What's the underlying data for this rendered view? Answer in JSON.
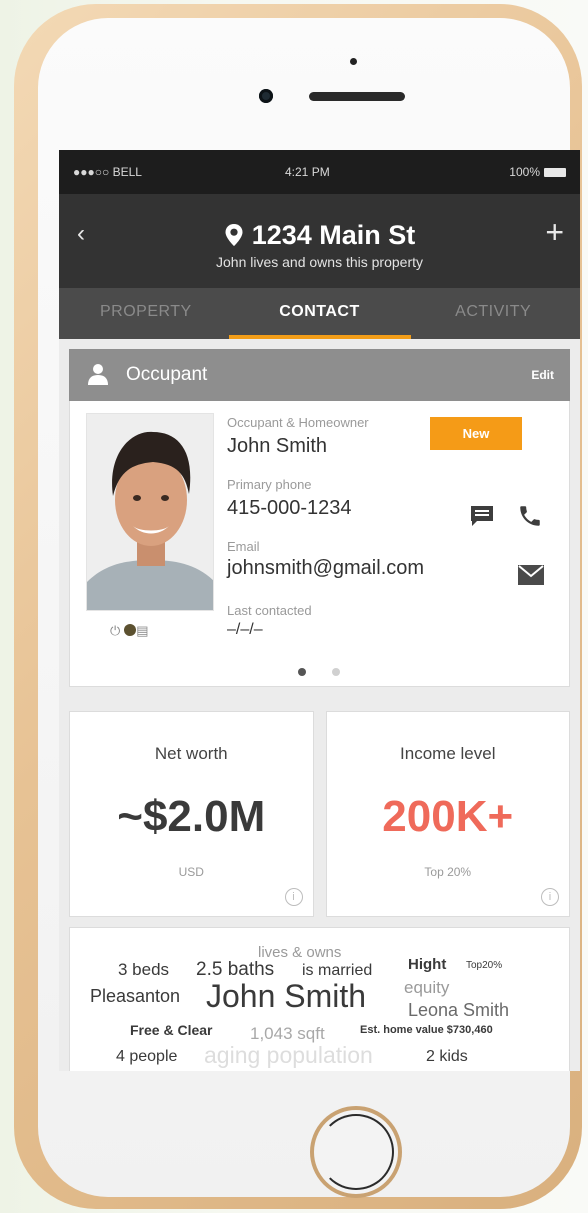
{
  "status_bar": {
    "carrier": "●●●○○ BELL",
    "time": "4:21 PM",
    "battery": "100%"
  },
  "header": {
    "back_glyph": "‹",
    "title": "1234 Main St",
    "subtitle": "John lives and owns this property",
    "add_glyph": "+"
  },
  "tabs": [
    {
      "label": "PROPERTY"
    },
    {
      "label": "CONTACT"
    },
    {
      "label": "ACTIVITY"
    }
  ],
  "active_tab": "CONTACT",
  "occupant_section": {
    "label": "Occupant",
    "edit": "Edit"
  },
  "contact_card": {
    "role_label": "Occupant & Homeowner",
    "badge": "New",
    "name": "John Smith",
    "phone_label": "Primary phone",
    "phone": "415-000-1234",
    "email_label": "Email",
    "email": "johnsmith@gmail.com",
    "last_contacted_label": "Last contacted",
    "last_contacted": "–/–/–",
    "pager": {
      "pages": 2,
      "current": 1
    }
  },
  "stats": [
    {
      "title": "Net worth",
      "value": "~$2.0M",
      "sub": "USD",
      "color": "#3a3a3a"
    },
    {
      "title": "Income level",
      "value": "200K+",
      "sub": "Top 20%",
      "color": "#ef6a5a"
    }
  ],
  "word_cloud": {
    "lives_owns": "lives & owns",
    "beds": "3 beds",
    "baths": "2.5 baths",
    "married": "is married",
    "hight": "Hight",
    "top20": "Top20%",
    "pleasanton": "Pleasanton",
    "name": "John Smith",
    "equity": "equity",
    "leona": "Leona Smith",
    "free_clear": "Free & Clear",
    "sqft": "1,043 sqft",
    "est_value": "Est. home value $730,460",
    "people": "4 people",
    "aging": "aging population",
    "kids": "2 kids"
  },
  "colors": {
    "accent": "#f29d18",
    "header_bg": "#333333",
    "tabs_bg": "#4b4b4b",
    "income": "#ef6a5a"
  }
}
